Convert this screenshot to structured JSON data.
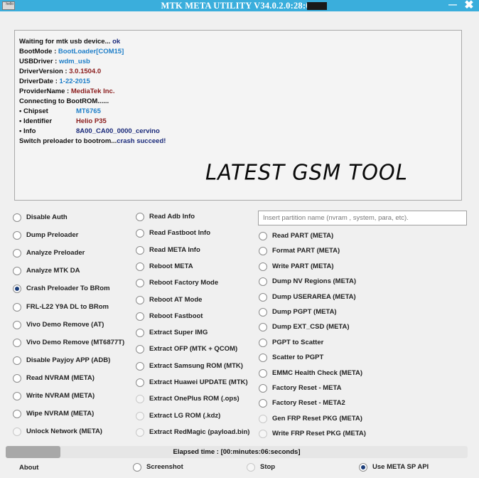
{
  "window": {
    "title": "MTK META UTILITY V34.0.2.0:28:02:",
    "app_icon_text": "hello",
    "minimize_icon": "minimize-icon",
    "close_icon": "close-icon"
  },
  "log": {
    "waiting": "Waiting for mtk usb device... ",
    "waiting_status": "ok",
    "bootmode_label": "BootMode : ",
    "bootmode_value": "BootLoader[COM15]",
    "usbdriver_label": "USBDriver : ",
    "usbdriver_value": "wdm_usb",
    "driverversion_label": "DriverVersion : ",
    "driverversion_value": "3.0.1504.0",
    "driverdate_label": "DriverDate : ",
    "driverdate_value": "1-22-2015",
    "provider_label": "ProviderName : ",
    "provider_value": "MediaTek Inc.",
    "connecting": "Connecting to BootROM......",
    "chipset_label": "• Chipset",
    "chipset_value": "MT6765",
    "identifier_label": "• Identifier",
    "identifier_value": "Helio P35",
    "info_label": "• Info",
    "info_value": "8A00_CA00_0000_cervino",
    "switch_text": "Switch preloader to bootrom...",
    "switch_status": "crash succeed!",
    "watermark": "LATEST GSM TOOL"
  },
  "col1": [
    {
      "label": "Disable Auth",
      "checked": false,
      "disabled": false
    },
    {
      "label": "Dump Preloader",
      "checked": false,
      "disabled": false
    },
    {
      "label": "Analyze Preloader",
      "checked": false,
      "disabled": false
    },
    {
      "label": "Analyze MTK DA",
      "checked": false,
      "disabled": false
    },
    {
      "label": "Crash Preloader To BRom",
      "checked": true,
      "disabled": false
    },
    {
      "label": "FRL-L22 Y9A DL to BRom",
      "checked": false,
      "disabled": false
    },
    {
      "label": "Vivo Demo Remove (AT)",
      "checked": false,
      "disabled": false
    },
    {
      "label": "Vivo Demo Remove (MT6877T)",
      "checked": false,
      "disabled": false
    },
    {
      "label": "Disable Payjoy APP (ADB)",
      "checked": false,
      "disabled": false
    },
    {
      "label": "Read NVRAM (META)",
      "checked": false,
      "disabled": false
    },
    {
      "label": "Write NVRAM (META)",
      "checked": false,
      "disabled": false
    },
    {
      "label": "Wipe NVRAM (META)",
      "checked": false,
      "disabled": false
    },
    {
      "label": "Unlock Network (META)",
      "checked": false,
      "disabled": true
    }
  ],
  "col2": [
    {
      "label": "Read Adb Info",
      "checked": false,
      "disabled": false
    },
    {
      "label": "Read Fastboot Info",
      "checked": false,
      "disabled": false
    },
    {
      "label": "Read META Info",
      "checked": false,
      "disabled": false
    },
    {
      "label": "Reboot META",
      "checked": false,
      "disabled": false
    },
    {
      "label": "Reboot Factory Mode",
      "checked": false,
      "disabled": false
    },
    {
      "label": "Reboot AT Mode",
      "checked": false,
      "disabled": false
    },
    {
      "label": "Reboot Fastboot",
      "checked": false,
      "disabled": false
    },
    {
      "label": "Extract Super IMG",
      "checked": false,
      "disabled": false
    },
    {
      "label": "Extract OFP (MTK + QCOM)",
      "checked": false,
      "disabled": false
    },
    {
      "label": "Extract Samsung ROM (MTK)",
      "checked": false,
      "disabled": false
    },
    {
      "label": "Extract Huawei UPDATE (MTK)",
      "checked": false,
      "disabled": false
    },
    {
      "label": "Extract OnePlus ROM (.ops)",
      "checked": false,
      "disabled": true
    },
    {
      "label": "Extract LG ROM (.kdz)",
      "checked": false,
      "disabled": true
    },
    {
      "label": "Extract RedMagic (payload.bin)",
      "checked": false,
      "disabled": true
    }
  ],
  "partition": {
    "placeholder": "Insert partition name (nvram , system, para, etc).",
    "value": ""
  },
  "col3": [
    {
      "label": "Read PART (META)",
      "checked": false,
      "disabled": false
    },
    {
      "label": "Format PART (META)",
      "checked": false,
      "disabled": false
    },
    {
      "label": "Write PART (META)",
      "checked": false,
      "disabled": false
    },
    {
      "label": "Dump NV Regions (META)",
      "checked": false,
      "disabled": false
    },
    {
      "label": "Dump USERAREA (META)",
      "checked": false,
      "disabled": false
    },
    {
      "label": "Dump PGPT (META)",
      "checked": false,
      "disabled": false
    },
    {
      "label": "Dump  EXT_CSD (META)",
      "checked": false,
      "disabled": false
    },
    {
      "label": "PGPT to Scatter",
      "checked": false,
      "disabled": false
    },
    {
      "label": "Scatter to PGPT",
      "checked": false,
      "disabled": false
    },
    {
      "label": "EMMC Health Check (META)",
      "checked": false,
      "disabled": false
    },
    {
      "label": "Factory Reset - META",
      "checked": false,
      "disabled": false
    },
    {
      "label": "Factory Reset - META2",
      "checked": false,
      "disabled": false
    },
    {
      "label": "Gen FRP Reset PKG (META)",
      "checked": false,
      "disabled": true
    },
    {
      "label": "Write FRP Reset PKG (META)",
      "checked": false,
      "disabled": true
    }
  ],
  "progress": {
    "fraction": 0.118,
    "elapsed": "Elapsed time : [00:minutes:06:seconds]"
  },
  "bottom": {
    "about": "About",
    "screenshot": "Screenshot",
    "stop": "Stop",
    "use_meta_sp_api": "Use META SP API"
  }
}
